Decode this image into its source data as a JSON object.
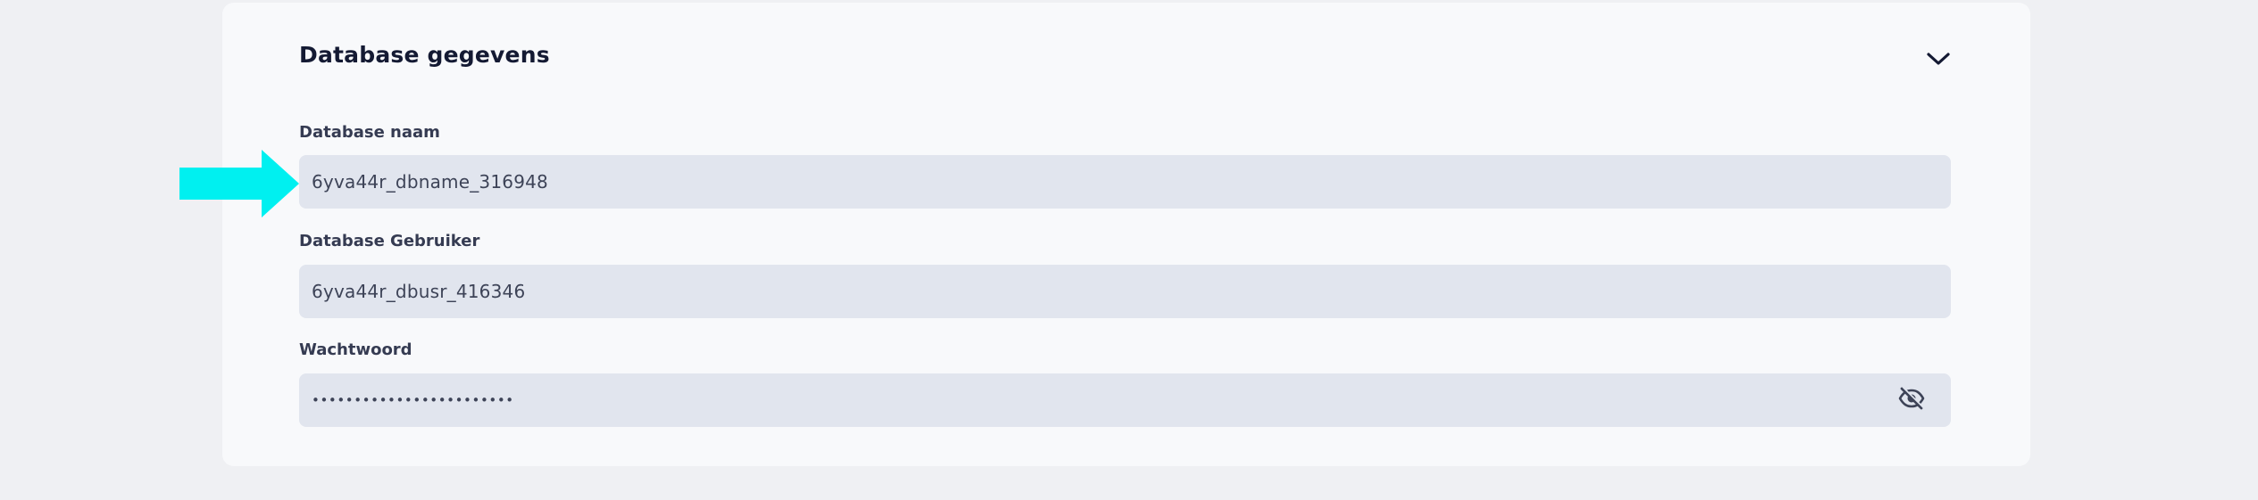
{
  "section": {
    "title": "Database gegevens",
    "toggle_icon": "chevron-down-icon"
  },
  "fields": [
    {
      "label": "Database naam",
      "value": "6yva44r_dbname_316948"
    },
    {
      "label": "Database Gebruiker",
      "value": "6yva44r_dbusr_416346"
    },
    {
      "label": "Wachtwoord",
      "value": "••••••••••••••••••••••••",
      "toggle_icon": "eye-off-icon"
    }
  ],
  "annotation": {
    "arrow_icon": "arrow-right-icon",
    "color": "#00f0f0"
  },
  "colors": {
    "page_bg": "#eff0f3",
    "card_bg": "#f8f9fb",
    "field_bg": "#e1e5ee",
    "title_text": "#141a33",
    "label_text": "#353b52",
    "value_text": "#3d4357"
  }
}
